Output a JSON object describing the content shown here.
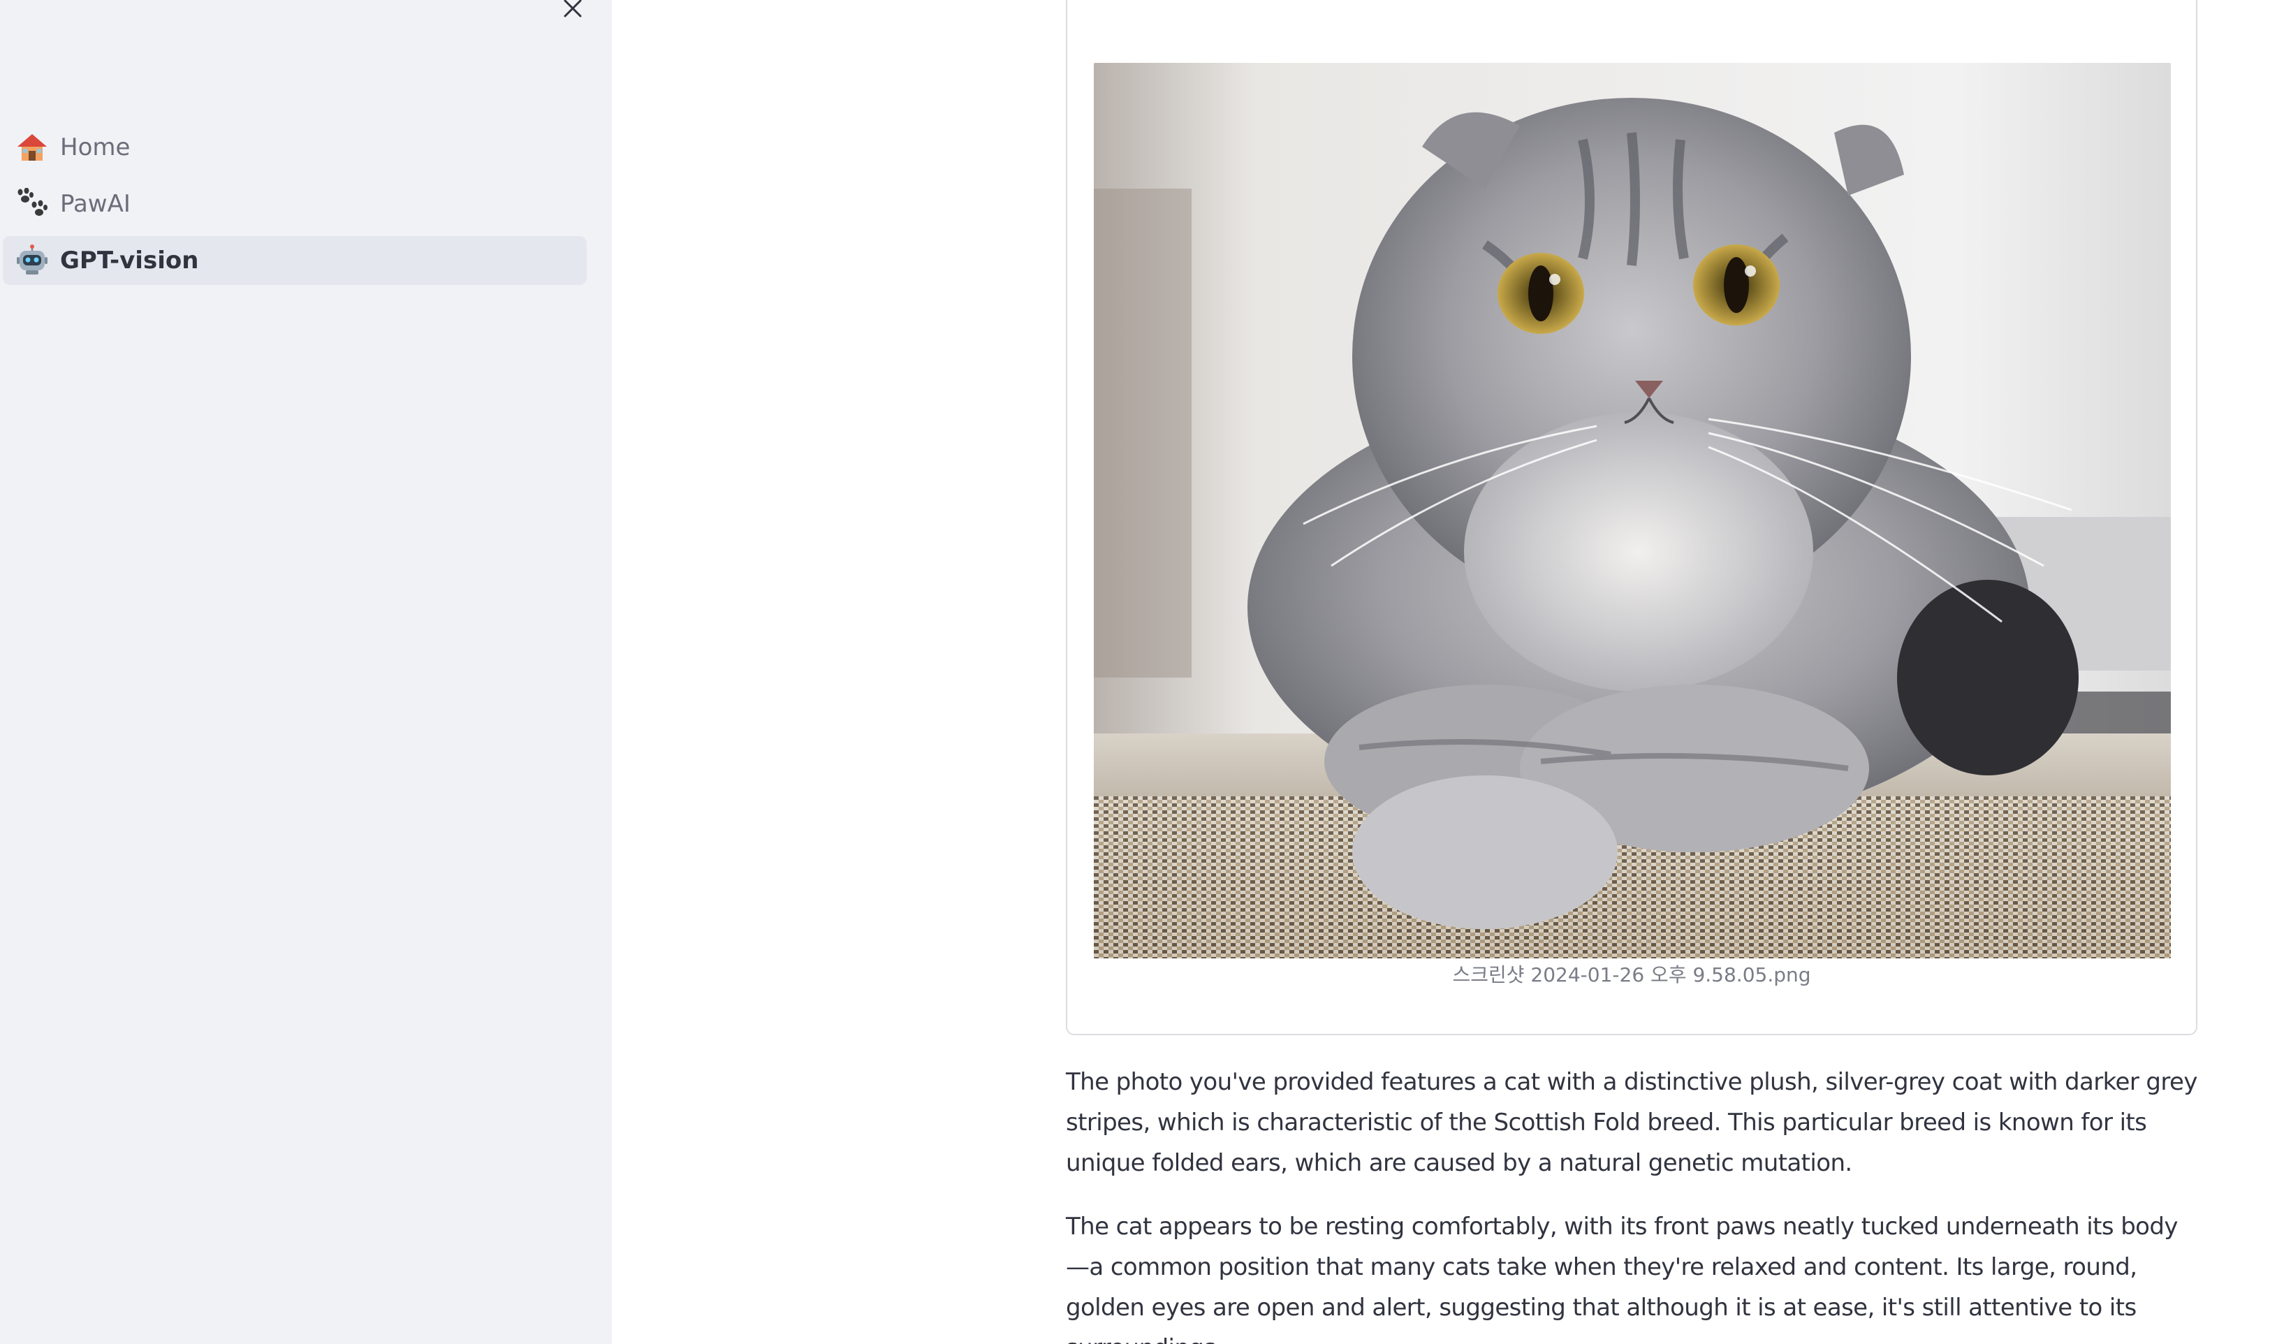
{
  "sidebar": {
    "close_icon": "close-icon",
    "items": [
      {
        "label": "Home",
        "icon": "house-emoji-icon",
        "active": false
      },
      {
        "label": "PawAI",
        "icon": "paw-prints-emoji-icon",
        "active": false
      },
      {
        "label": "GPT-vision",
        "icon": "robot-emoji-icon",
        "active": true
      }
    ]
  },
  "main": {
    "image": {
      "alt": "cat photo",
      "caption": "스크린샷 2024-01-26 오후 9.58.05.png"
    },
    "response": {
      "paragraph1": "The photo you've provided features a cat with a distinctive plush, silver-grey coat with darker grey stripes, which is characteristic of the Scottish Fold breed. This particular breed is known for its unique folded ears, which are caused by a natural genetic mutation.",
      "paragraph2": "The cat appears to be resting comfortably, with its front paws neatly tucked underneath its body—a common position that many cats take when they're relaxed and content. Its large, round, golden eyes are open and alert, suggesting that although it is at ease, it's still attentive to its surroundings."
    }
  },
  "colors": {
    "sidebar_bg": "#f0f2f6",
    "active_item_bg": "#e4e7ee",
    "text": "#31333f",
    "muted_text": "#6b6e7a",
    "border": "#dcdde3"
  }
}
